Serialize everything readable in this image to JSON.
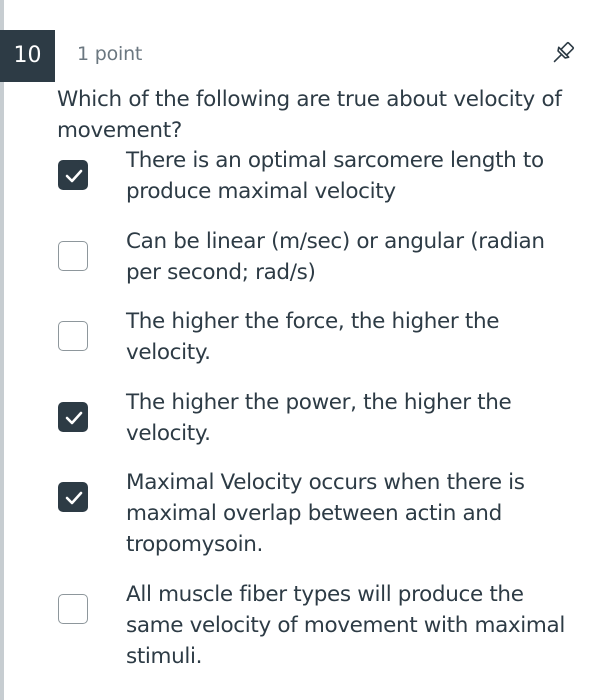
{
  "question": {
    "number": "10",
    "points": "1 point",
    "text": "Which of the following are true about velocity of movement?",
    "pin_icon": "pin-icon"
  },
  "answers": [
    {
      "label": "There is an optimal sarcomere length to produce maximal velocity",
      "checked": true
    },
    {
      "label": "Can be linear (m/sec) or angular (radian per second; rad/s)",
      "checked": false
    },
    {
      "label": "The higher the force, the higher the velocity.",
      "checked": false
    },
    {
      "label": "The higher the power, the higher the velocity.",
      "checked": true
    },
    {
      "label": "Maximal Velocity occurs when there is maximal overlap between actin and tropomysoin.",
      "checked": true
    },
    {
      "label": "All muscle fiber types will produce the same velocity of movement with maximal stimuli.",
      "checked": false
    }
  ],
  "colors": {
    "text": "#2d3b45",
    "checked_fill": "#2d3b45",
    "muted": "#6b7780"
  }
}
